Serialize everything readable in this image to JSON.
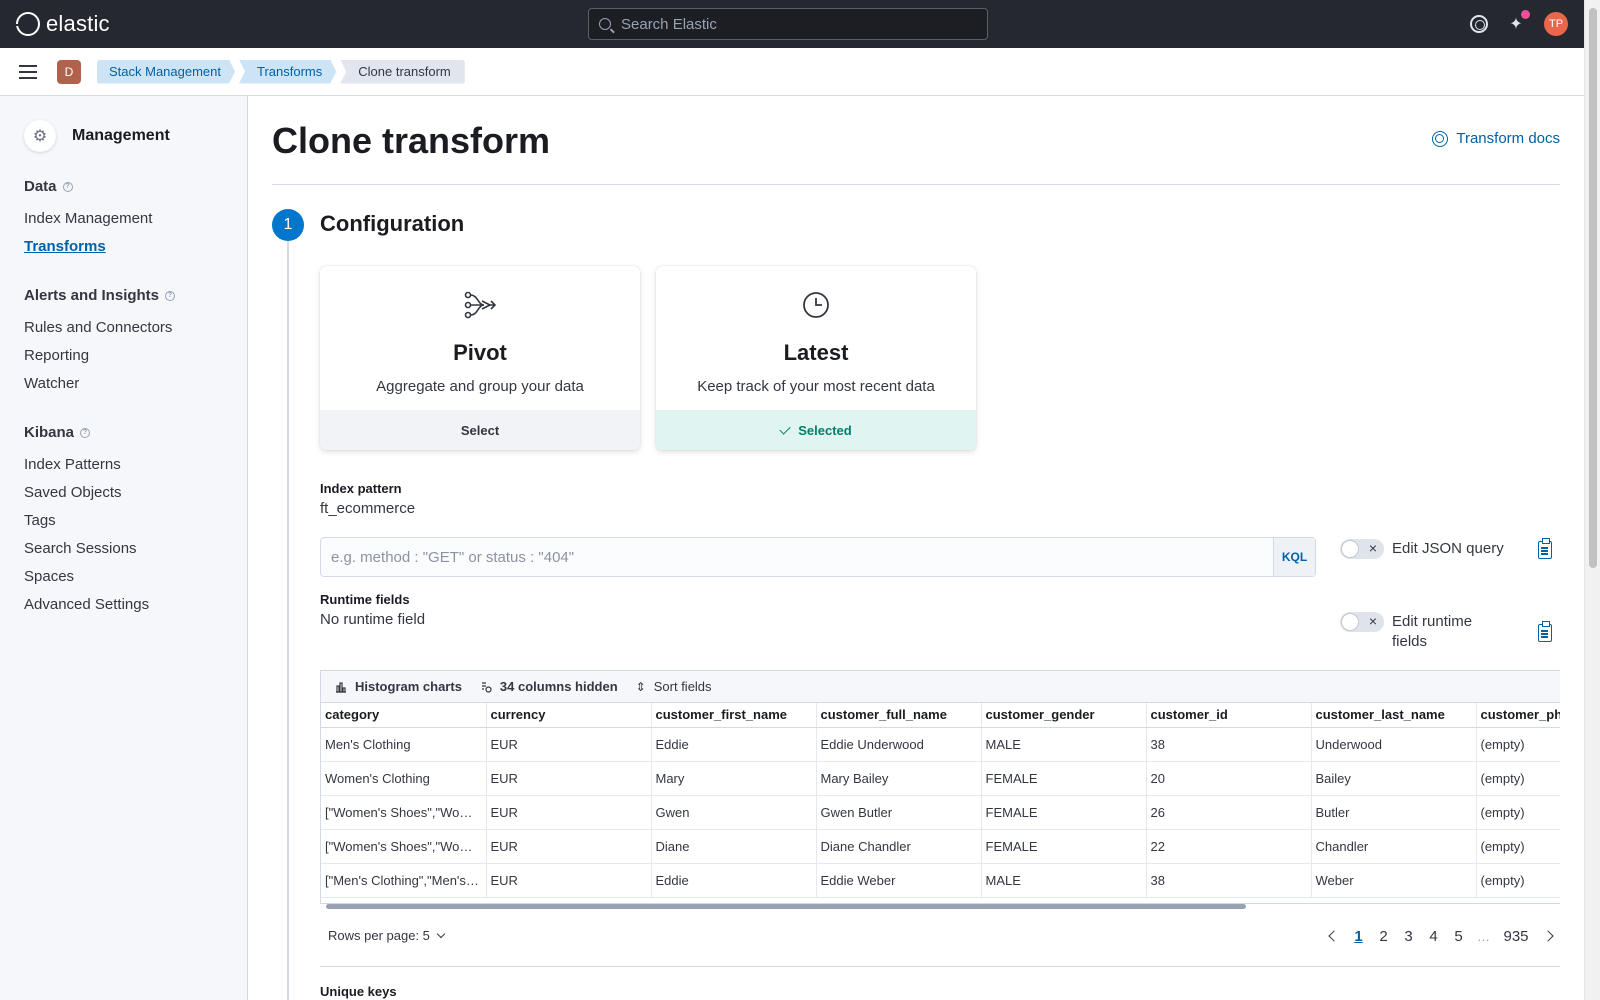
{
  "header": {
    "logo_text": "elastic",
    "search_placeholder": "Search Elastic",
    "avatar_initials": "TP"
  },
  "breadcrumb": {
    "space_initial": "D",
    "items": [
      "Stack Management",
      "Transforms",
      "Clone transform"
    ]
  },
  "sidebar": {
    "title": "Management",
    "groups": [
      {
        "title": "Data",
        "items": [
          "Index Management",
          "Transforms"
        ]
      },
      {
        "title": "Alerts and Insights",
        "items": [
          "Rules and Connectors",
          "Reporting",
          "Watcher"
        ]
      },
      {
        "title": "Kibana",
        "items": [
          "Index Patterns",
          "Saved Objects",
          "Tags",
          "Search Sessions",
          "Spaces",
          "Advanced Settings"
        ]
      }
    ],
    "active_item": "Transforms"
  },
  "page": {
    "title": "Clone transform",
    "docs_link": "Transform docs",
    "step_number": "1",
    "step_title": "Configuration"
  },
  "cards": [
    {
      "title": "Pivot",
      "description": "Aggregate and group your data",
      "footer": "Select",
      "selected": false
    },
    {
      "title": "Latest",
      "description": "Keep track of your most recent data",
      "footer": "Selected",
      "selected": true
    }
  ],
  "index_pattern": {
    "label": "Index pattern",
    "value": "ft_ecommerce"
  },
  "query": {
    "placeholder": "e.g. method : \"GET\" or status : \"404\"",
    "language": "KQL"
  },
  "edit_json": {
    "label": "Edit JSON query",
    "on": false
  },
  "runtime": {
    "label": "Runtime fields",
    "value": "No runtime field",
    "switch_label_1": "Edit runtime",
    "switch_label_2": "fields",
    "on": false
  },
  "grid": {
    "toolbar": {
      "histogram": "Histogram charts",
      "hidden": "34 columns hidden",
      "sort": "Sort fields"
    },
    "columns": [
      "category",
      "currency",
      "customer_first_name",
      "customer_full_name",
      "customer_gender",
      "customer_id",
      "customer_last_name",
      "customer_phone"
    ],
    "rows": [
      [
        "Men's Clothing",
        "EUR",
        "Eddie",
        "Eddie Underwood",
        "MALE",
        "38",
        "Underwood",
        "(empty)"
      ],
      [
        "Women's Clothing",
        "EUR",
        "Mary",
        "Mary Bailey",
        "FEMALE",
        "20",
        "Bailey",
        "(empty)"
      ],
      [
        "[\"Women's Shoes\",\"Women's Clothing\"]",
        "EUR",
        "Gwen",
        "Gwen Butler",
        "FEMALE",
        "26",
        "Butler",
        "(empty)"
      ],
      [
        "[\"Women's Shoes\",\"Women's Clothing\"]",
        "EUR",
        "Diane",
        "Diane Chandler",
        "FEMALE",
        "22",
        "Chandler",
        "(empty)"
      ],
      [
        "[\"Men's Clothing\",\"Men's Shoes\"]",
        "EUR",
        "Eddie",
        "Eddie Weber",
        "MALE",
        "38",
        "Weber",
        "(empty)"
      ]
    ]
  },
  "pagination": {
    "rows_per_page": "Rows per page: 5",
    "pages": [
      "1",
      "2",
      "3",
      "4",
      "5"
    ],
    "ellipsis": "…",
    "last_page": "935",
    "current": "1"
  },
  "unique_keys_label": "Unique keys",
  "colors": {
    "accent": "#0077cc",
    "header_bg": "#25282f",
    "selected_bg": "#e0f5f1"
  }
}
